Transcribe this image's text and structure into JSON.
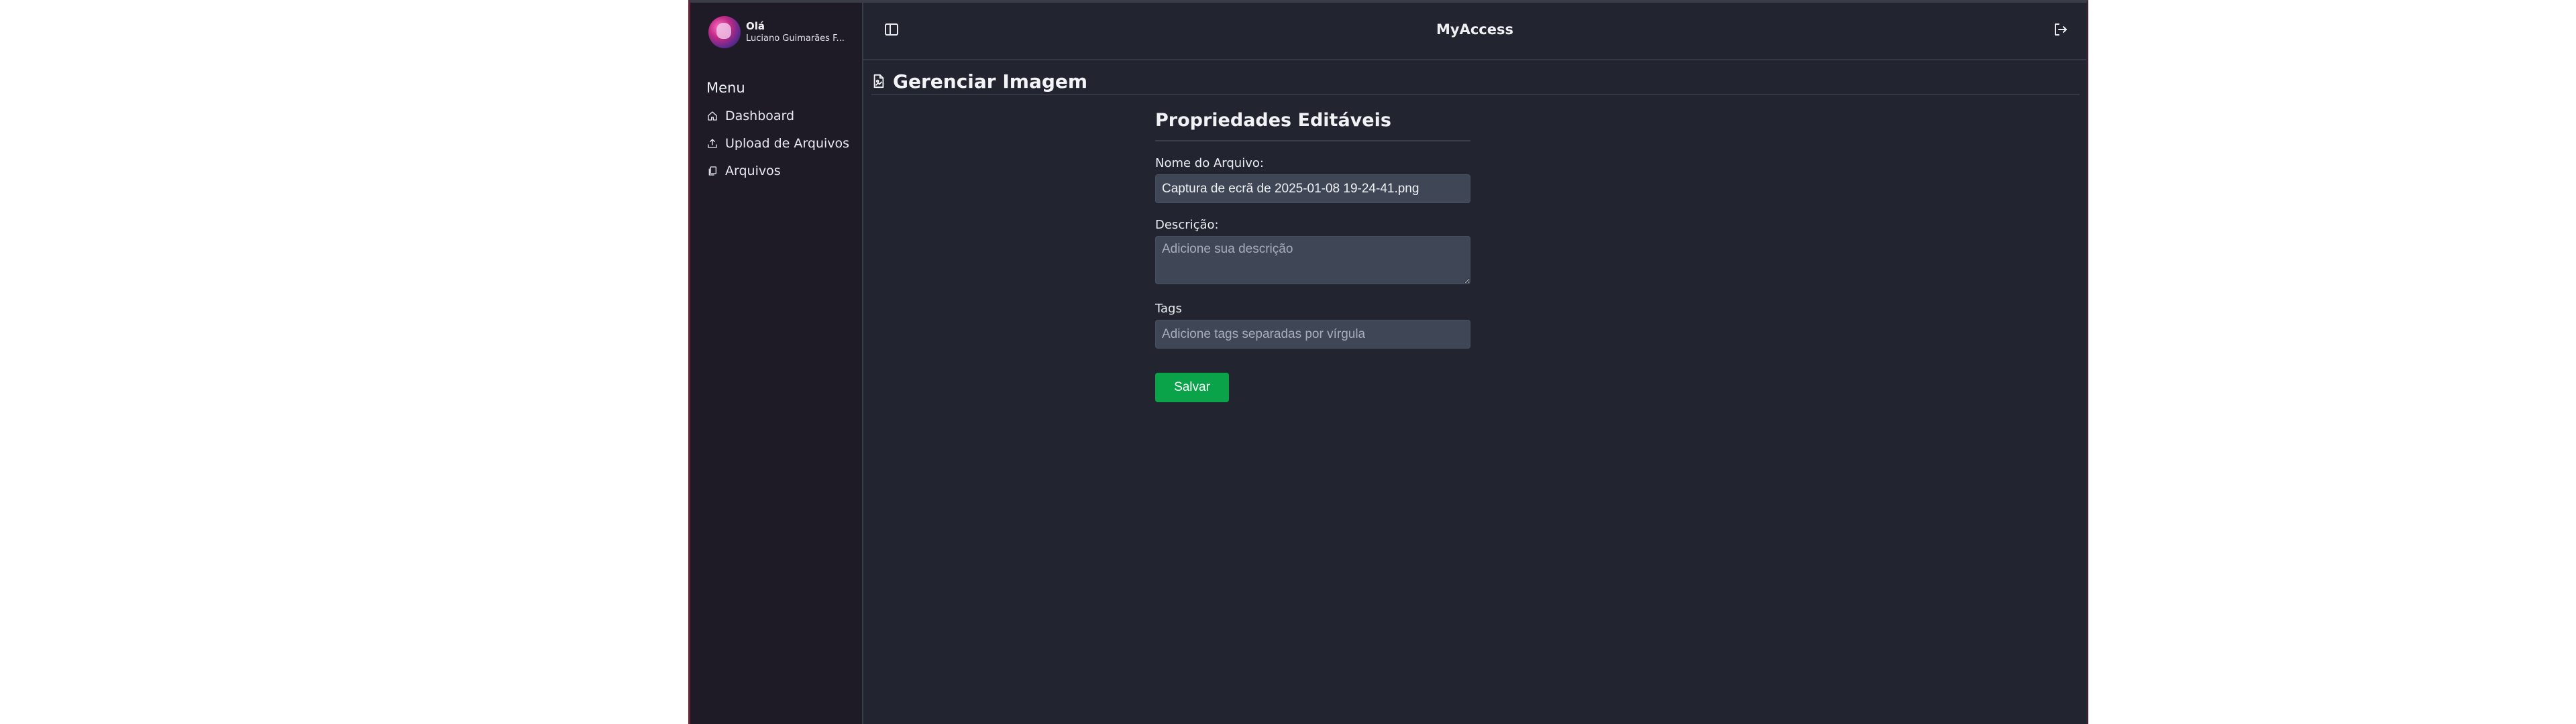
{
  "sidebar": {
    "greeting": "Olá",
    "user_name": "Luciano Guimarães F...",
    "menu_title": "Menu",
    "items": [
      {
        "label": "Dashboard",
        "icon": "home-icon"
      },
      {
        "label": "Upload de Arquivos",
        "icon": "upload-icon"
      },
      {
        "label": "Arquivos",
        "icon": "files-icon"
      }
    ]
  },
  "header": {
    "app_title": "MyAccess",
    "toggle_icon": "sidebar-toggle-icon",
    "logout_icon": "logout-icon"
  },
  "page": {
    "title": "Gerenciar Imagem",
    "title_icon": "image-file-icon"
  },
  "form": {
    "section_title": "Propriedades Editáveis",
    "filename_label": "Nome do Arquivo:",
    "filename_value": "Captura de ecrã de 2025-01-08 19-24-41.png",
    "description_label": "Descrição:",
    "description_placeholder": "Adicione sua descrição",
    "tags_label": "Tags",
    "tags_placeholder": "Adicione tags separadas por vírgula",
    "save_label": "Salvar"
  },
  "colors": {
    "background": "#222530",
    "sidebar": "#1e1b27",
    "input_bg": "#3f4656",
    "accent_green": "#0aa34a"
  }
}
